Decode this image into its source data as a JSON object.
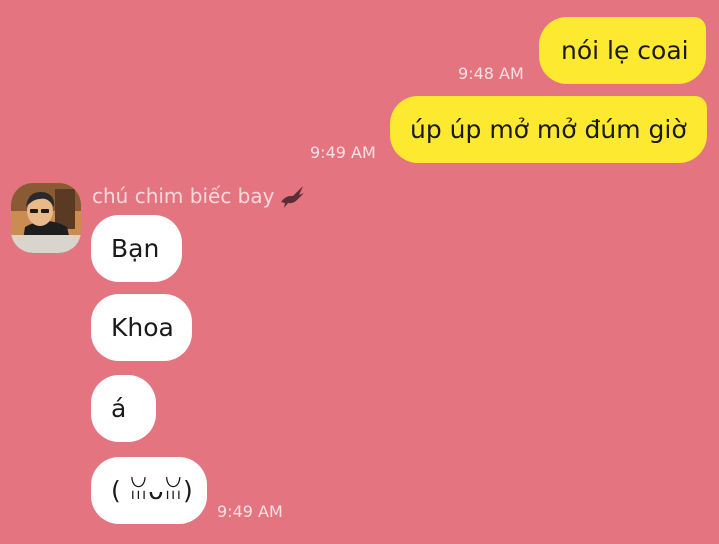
{
  "chat": {
    "outgoing_messages": [
      {
        "text": "nói lẹ coai",
        "time": "9:48 AM"
      },
      {
        "text": "úp úp mở mở đúm giờ",
        "time": "9:49 AM"
      }
    ],
    "incoming": {
      "sender_name": "chú chim biếc bay",
      "sender_badge_icon": "eagle-icon",
      "messages": [
        {
          "text": "Bạn"
        },
        {
          "text": "Khoa"
        },
        {
          "text": "á"
        },
        {
          "text": "( ꈍᴗꈍ)",
          "time": "9:49 AM"
        }
      ]
    },
    "colors": {
      "background": "#e47580",
      "outgoing_bubble": "#fde92f",
      "incoming_bubble": "#ffffff"
    }
  }
}
